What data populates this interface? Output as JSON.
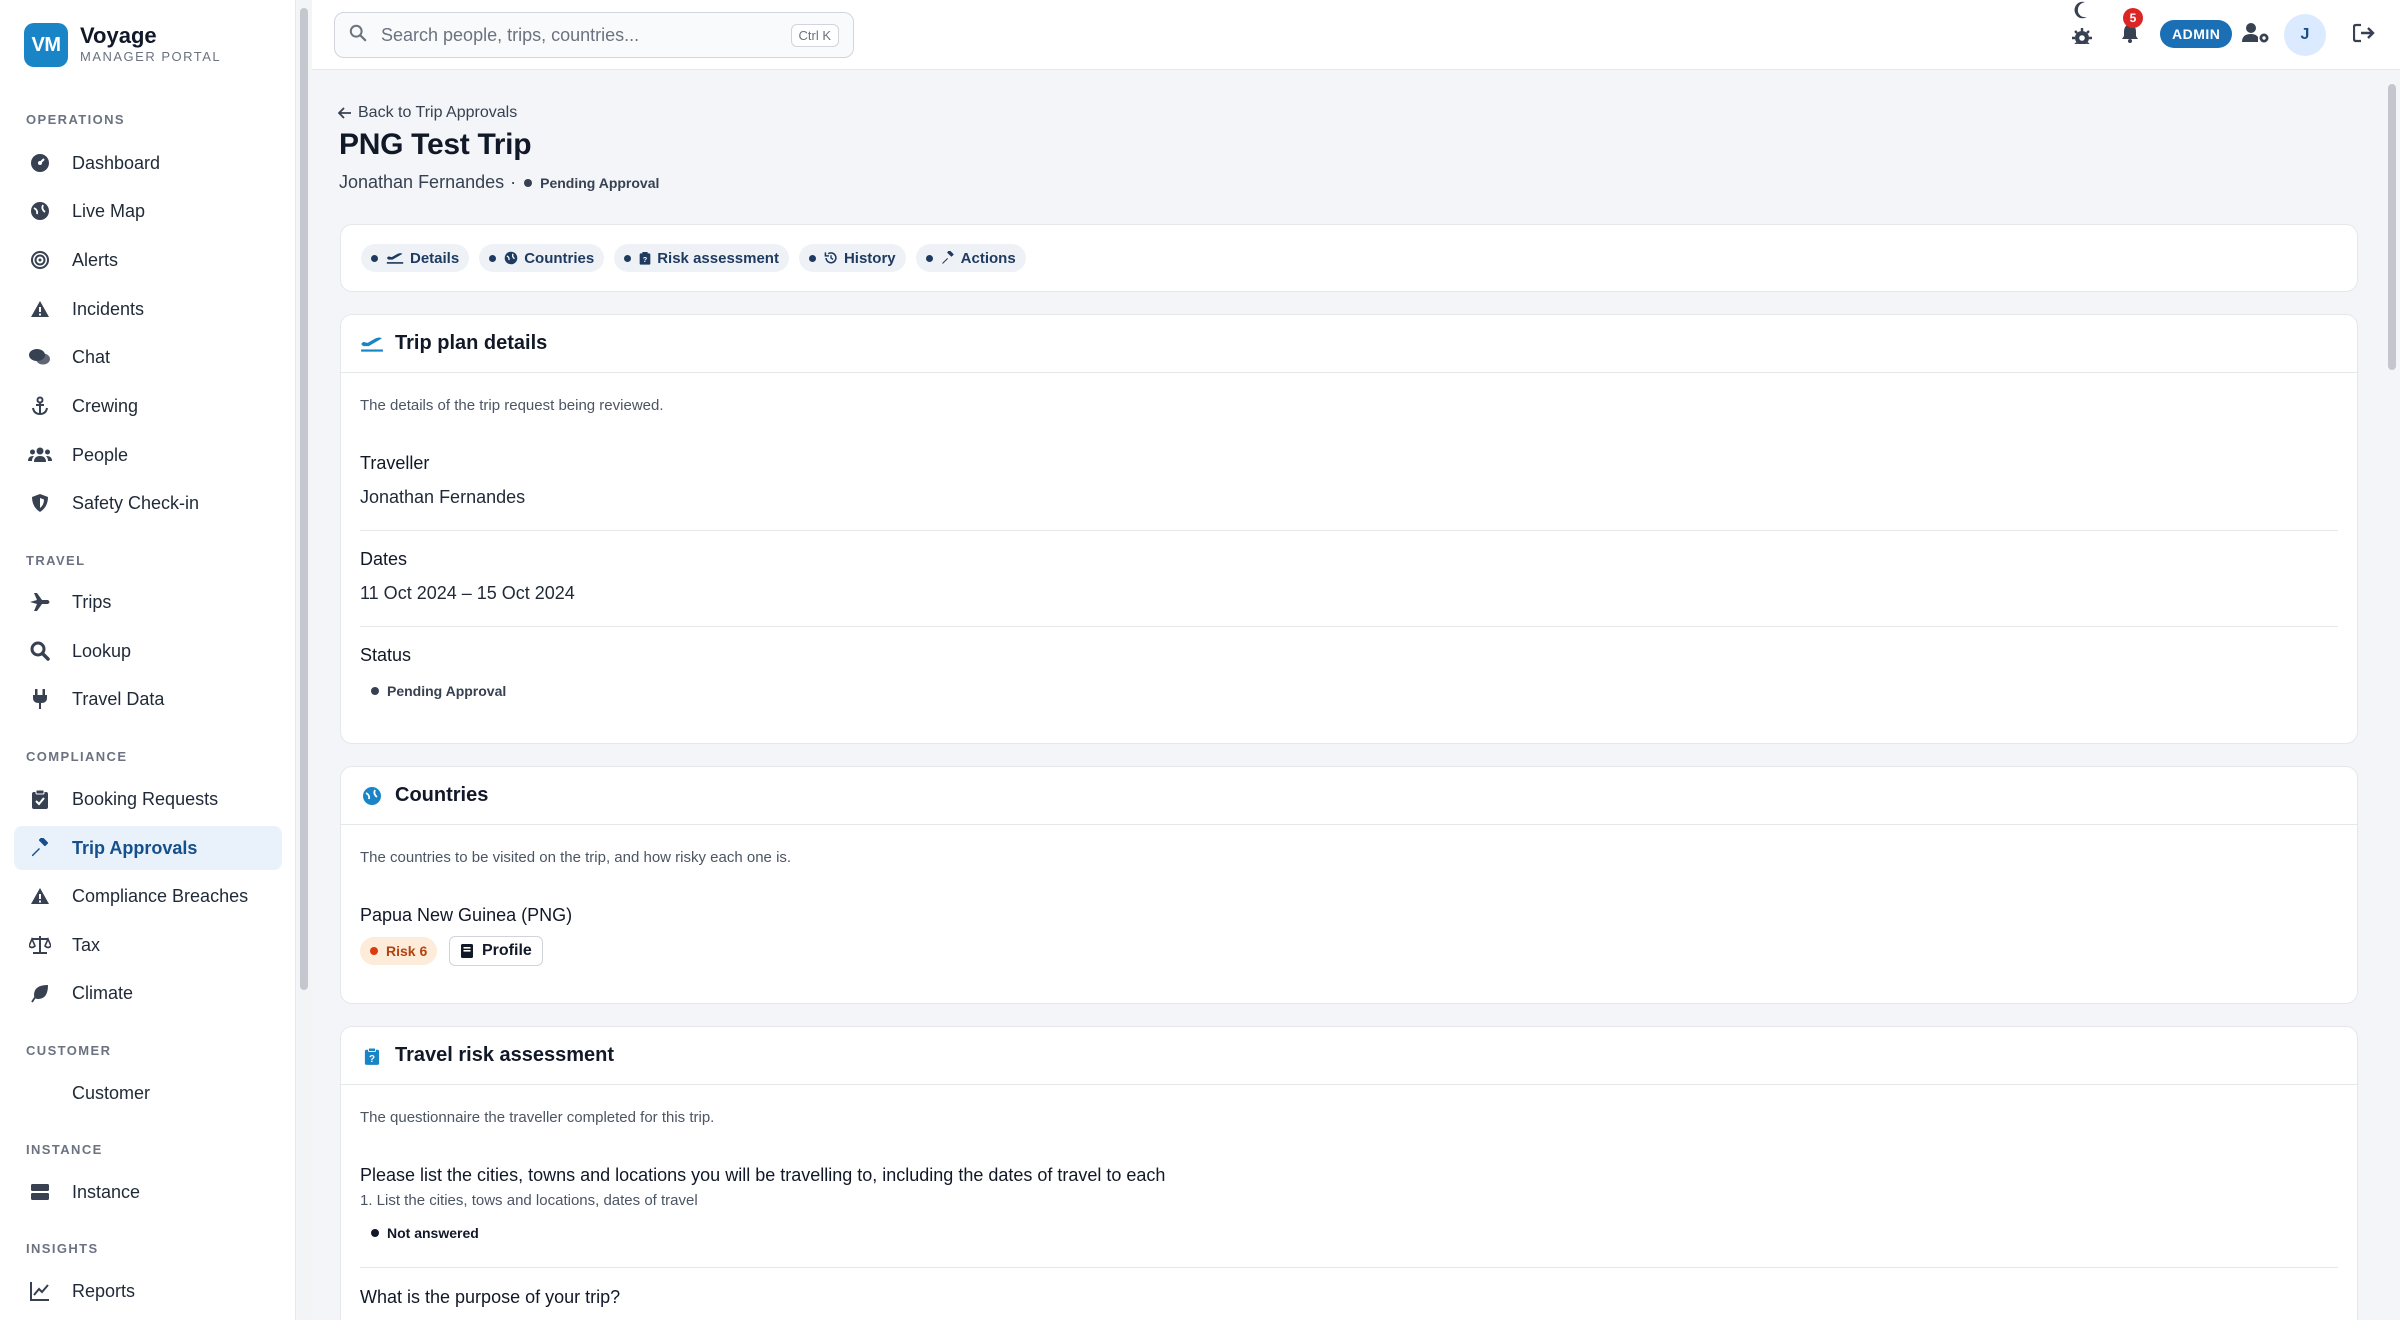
{
  "brand": {
    "initials": "VM",
    "name": "Voyage",
    "subtitle": "MANAGER PORTAL"
  },
  "sidebar": {
    "sections": [
      {
        "label": "OPERATIONS"
      },
      {
        "label": "TRAVEL"
      },
      {
        "label": "COMPLIANCE"
      },
      {
        "label": "CUSTOMER"
      },
      {
        "label": "INSTANCE"
      },
      {
        "label": "INSIGHTS"
      }
    ],
    "items": [
      {
        "label": "Dashboard",
        "icon": "dashboard-icon"
      },
      {
        "label": "Live Map",
        "icon": "globe-icon"
      },
      {
        "label": "Alerts",
        "icon": "target-icon"
      },
      {
        "label": "Incidents",
        "icon": "warning-icon"
      },
      {
        "label": "Chat",
        "icon": "chat-icon"
      },
      {
        "label": "Crewing",
        "icon": "anchor-icon"
      },
      {
        "label": "People",
        "icon": "people-icon"
      },
      {
        "label": "Safety Check-in",
        "icon": "shield-icon"
      },
      {
        "label": "Trips",
        "icon": "plane-icon"
      },
      {
        "label": "Lookup",
        "icon": "search-icon"
      },
      {
        "label": "Travel Data",
        "icon": "plug-icon"
      },
      {
        "label": "Booking Requests",
        "icon": "clipboard-icon"
      },
      {
        "label": "Trip Approvals",
        "icon": "gavel-icon",
        "active": true
      },
      {
        "label": "Compliance Breaches",
        "icon": "warning-icon"
      },
      {
        "label": "Tax",
        "icon": "scale-icon"
      },
      {
        "label": "Climate",
        "icon": "leaf-icon"
      },
      {
        "label": "Customer"
      },
      {
        "label": "Instance",
        "icon": "server-icon"
      },
      {
        "label": "Reports",
        "icon": "chart-line-icon"
      }
    ]
  },
  "topbar": {
    "search_placeholder": "Search people, trips, countries...",
    "shortcut": "Ctrl K",
    "notification_count": "5",
    "role_badge": "ADMIN",
    "avatar_initial": "J"
  },
  "page": {
    "back_link": "Back to Trip Approvals",
    "title": "PNG Test Trip",
    "traveller": "Jonathan Fernandes",
    "separator": "·",
    "status": "Pending Approval"
  },
  "tabs": [
    "Details",
    "Countries",
    "Risk assessment",
    "History",
    "Actions"
  ],
  "details": {
    "title": "Trip plan details",
    "description": "The details of the trip request being reviewed.",
    "traveller_label": "Traveller",
    "traveller_value": "Jonathan Fernandes",
    "dates_label": "Dates",
    "dates_value": "11 Oct 2024 – 15 Oct 2024",
    "status_label": "Status",
    "status_value": "Pending Approval"
  },
  "countries": {
    "title": "Countries",
    "description": "The countries to be visited on the trip, and how risky each one is.",
    "items": [
      {
        "name": "Papua New Guinea (PNG)",
        "risk": "Risk 6",
        "profile_label": "Profile"
      }
    ]
  },
  "risk_assessment": {
    "title": "Travel risk assessment",
    "description": "The questionnaire the traveller completed for this trip.",
    "questions": [
      {
        "question": "Please list the cities, towns and locations you will be travelling to, including the dates of travel to each",
        "hint": "1. List the cities, tows and locations, dates of travel",
        "answer": "Not answered"
      },
      {
        "question": "What is the purpose of your trip?"
      }
    ]
  },
  "colors": {
    "brand": "#1a85c6",
    "active_nav_bg": "#e9f2fb",
    "active_nav_text": "#15508c",
    "risk_bg": "#fdecd9",
    "risk_text": "#b4420e",
    "notification": "#dc2626"
  }
}
